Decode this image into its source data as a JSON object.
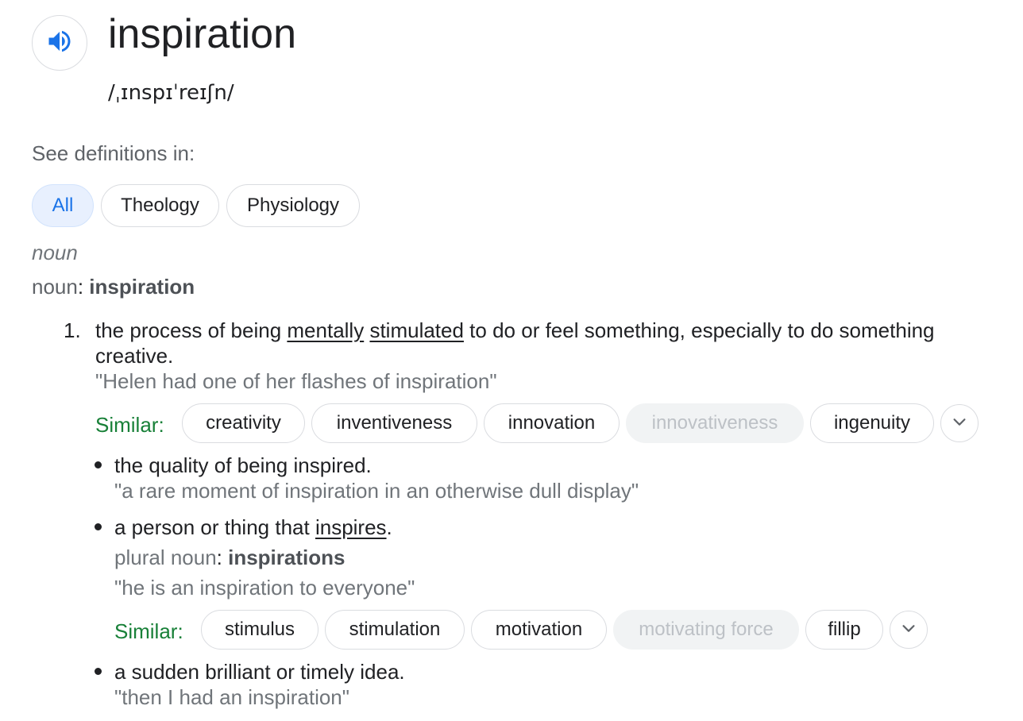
{
  "entry": {
    "word": "inspiration",
    "phonetic": "/ˌɪnspɪˈreɪʃn/",
    "speaker_icon": "speaker-icon"
  },
  "see_in": {
    "label": "See definitions in:",
    "chips": [
      "All",
      "Theology",
      "Physiology"
    ],
    "selected": "All"
  },
  "pos": {
    "italic": "noun",
    "label": "noun",
    "colon": ": ",
    "headword": "inspiration"
  },
  "sense1": {
    "number": "1.",
    "def_a": "the process of being ",
    "link1": "mentally",
    "def_b": " ",
    "link2": "stimulated",
    "def_c": " to do or feel something, especially to do something",
    "def_d": "creative.",
    "example": "\"Helen had one of her flashes of inspiration\"",
    "similar_label": "Similar:",
    "similar": [
      "creativity",
      "inventiveness",
      "innovation",
      "innovativeness",
      "ingenuity"
    ]
  },
  "sub1": {
    "def": "the quality of being inspired.",
    "example": "\"a rare moment of inspiration in an otherwise dull display\""
  },
  "sub2": {
    "def_a": "a person or thing that ",
    "link": "inspires",
    "def_b": ".",
    "plural_label": "plural noun",
    "plural_colon": ": ",
    "plural": "inspirations",
    "example": "\"he is an inspiration to everyone\"",
    "similar_label": "Similar:",
    "similar": [
      "stimulus",
      "stimulation",
      "motivation",
      "motivating force",
      "fillip"
    ]
  },
  "sub3": {
    "def": "a sudden brilliant or timely idea.",
    "example": "\"then I had an inspiration\""
  },
  "colors": {
    "accent": "#1a73e8",
    "similar_green": "#188038",
    "gray_text": "#70757a"
  }
}
